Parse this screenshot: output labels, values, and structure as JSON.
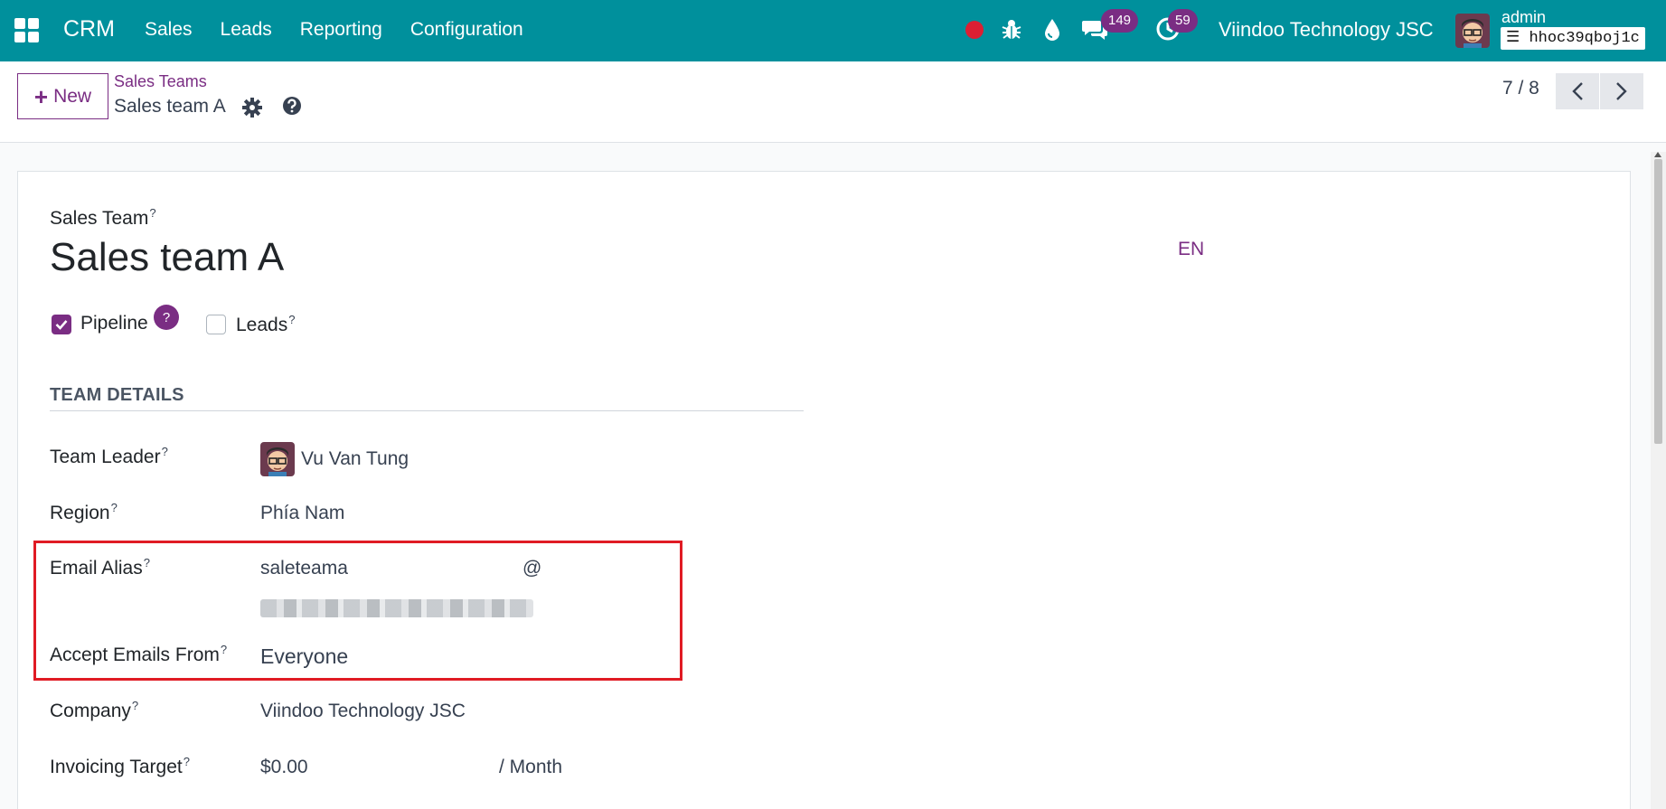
{
  "navbar": {
    "app_name": "CRM",
    "menu": [
      "Sales",
      "Leads",
      "Reporting",
      "Configuration"
    ],
    "chat_count": "149",
    "activity_count": "59",
    "company": "Viindoo Technology JSC",
    "user": "admin",
    "database": "hhoc39qboj1c",
    "colors": {
      "primary": "#00909c",
      "accent": "#7a2d83",
      "recording": "#dc1f33"
    }
  },
  "control_panel": {
    "new_label": "New",
    "breadcrumb_parent": "Sales Teams",
    "breadcrumb_current": "Sales team A",
    "pager": "7 / 8"
  },
  "form": {
    "title_label": "Sales Team",
    "title_value": "Sales team A",
    "language": "EN",
    "help_mark": "?",
    "pipeline_label": "Pipeline",
    "pipeline_checked": true,
    "leads_label": "Leads",
    "leads_checked": false,
    "section_title": "TEAM DETAILS",
    "fields": {
      "team_leader": {
        "label": "Team Leader",
        "value": "Vu Van Tung"
      },
      "region": {
        "label": "Region",
        "value": "Phía Nam"
      },
      "email_alias": {
        "label": "Email Alias",
        "value": "saleteama",
        "at": "@"
      },
      "accept_emails": {
        "label": "Accept Emails From",
        "value": "Everyone"
      },
      "company": {
        "label": "Company",
        "value": "Viindoo Technology JSC"
      },
      "invoicing_target": {
        "label": "Invoicing Target",
        "value": "$0.00",
        "period": "/ Month"
      }
    }
  }
}
